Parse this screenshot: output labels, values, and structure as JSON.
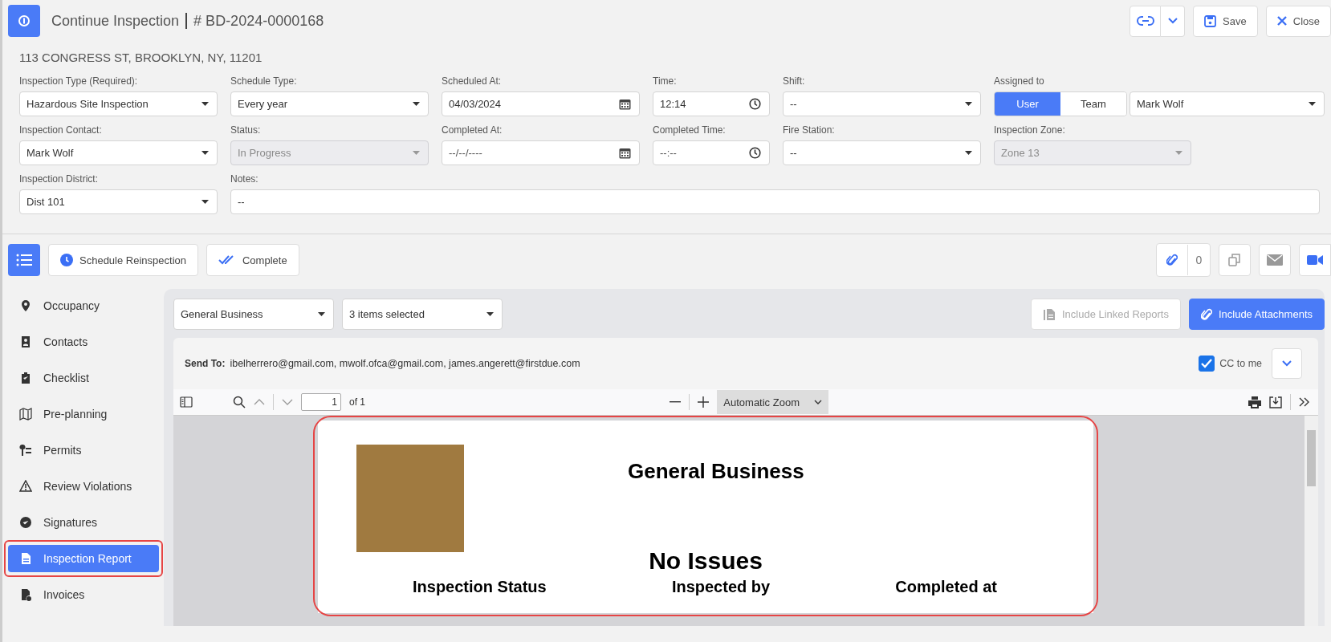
{
  "header": {
    "title": "Continue Inspection",
    "record_number": "# BD-2024-0000168",
    "address": "113 CONGRESS ST, BROOKLYN, NY, 11201"
  },
  "header_actions": [
    {
      "kind": "link"
    },
    {
      "kind": "caret"
    },
    {
      "kind": "save",
      "label": "Save"
    },
    {
      "kind": "close",
      "label": "Close"
    }
  ],
  "form": {
    "fields": [
      {
        "label": "Inspection Type (Required):",
        "kind": "select",
        "value": "Hazardous Site Inspection",
        "disabled": false
      },
      {
        "label": "Schedule Type:",
        "kind": "select",
        "value": "Every year",
        "disabled": false
      },
      {
        "label": "Scheduled At:",
        "kind": "date",
        "value": "04/03/2024",
        "disabled": false
      },
      {
        "label": "Time:",
        "kind": "time",
        "value": "12:14",
        "disabled": false
      },
      {
        "label": "Shift:",
        "kind": "select",
        "value": "--",
        "disabled": false
      },
      {
        "label": "Assigned to",
        "kind": "assign",
        "options": [
          {
            "label": "User",
            "selected": true
          },
          {
            "label": "Team",
            "selected": false
          }
        ],
        "value": "Mark Wolf",
        "disabled": false
      },
      {
        "label": "Inspection Contact:",
        "kind": "select",
        "value": "Mark Wolf",
        "disabled": false
      },
      {
        "label": "Status:",
        "kind": "select",
        "value": "In Progress",
        "disabled": true
      },
      {
        "label": "Completed At:",
        "kind": "date",
        "placeholder": "--/--/----",
        "disabled": false
      },
      {
        "label": "Completed Time:",
        "kind": "time",
        "placeholder": "--:--",
        "disabled": false
      },
      {
        "label": "Fire Station:",
        "kind": "select",
        "value": "--",
        "disabled": false
      },
      {
        "label": "Inspection Zone:",
        "kind": "select",
        "value": "Zone 13",
        "disabled": true
      },
      {
        "label": "Inspection District:",
        "kind": "select",
        "value": "Dist 101",
        "disabled": false
      },
      {
        "label": "Notes:",
        "kind": "notes",
        "value": "--",
        "disabled": false
      }
    ]
  },
  "toolbar": {
    "buttons": [
      {
        "kind": "menu"
      },
      {
        "kind": "schedule",
        "label": "Schedule Reinspection"
      },
      {
        "kind": "complete",
        "label": "Complete"
      }
    ],
    "attachment_count": "0"
  },
  "sidebar": {
    "items": [
      {
        "label": "Occupancy",
        "selected": false
      },
      {
        "label": "Contacts",
        "selected": false
      },
      {
        "label": "Checklist",
        "selected": false
      },
      {
        "label": "Pre-planning",
        "selected": false
      },
      {
        "label": "Permits",
        "selected": false
      },
      {
        "label": "Review Violations",
        "selected": false
      },
      {
        "label": "Signatures",
        "selected": false
      },
      {
        "label": "Inspection Report",
        "selected": true
      },
      {
        "label": "Invoices",
        "selected": false
      }
    ]
  },
  "report": {
    "filters": [
      {
        "value": "General Business"
      },
      {
        "value": "3 items selected"
      }
    ],
    "buttons": [
      {
        "label": "Include Linked Reports",
        "kind": "linked",
        "disabled": true
      },
      {
        "label": "Include Attachments",
        "kind": "attach",
        "disabled": false
      }
    ],
    "send_to": {
      "label": "Send To:",
      "value": "ibelherrero@gmail.com, mwolf.ofca@gmail.com, james.angerett@firstdue.com"
    },
    "cc": {
      "label": "CC to me",
      "checked": true
    },
    "viewer": {
      "page": "1",
      "page_count": "of 1",
      "zoom": "Automatic Zoom"
    },
    "document": {
      "title": "General Business",
      "heading": "No Issues",
      "columns": [
        "Inspection Status",
        "Inspected by",
        "Completed at"
      ]
    }
  }
}
